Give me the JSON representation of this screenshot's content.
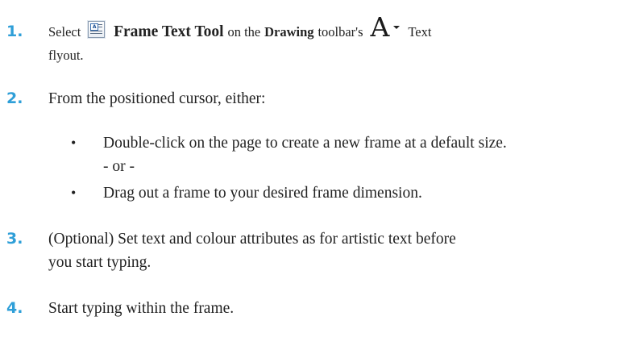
{
  "steps": [
    {
      "number": "1.",
      "text_select": "Select",
      "tool_name": "Frame Text Tool",
      "text_on_the": "on the",
      "toolbar_name": "Drawing",
      "text_toolbars": "toolbar's",
      "text_flyout_word": "Text",
      "text_flyout_end": "flyout."
    },
    {
      "number": "2.",
      "text": "From the positioned cursor, either:"
    },
    {
      "number": "3.",
      "line1": "(Optional) Set text and colour attributes as for artistic text before",
      "line2": "you start typing."
    },
    {
      "number": "4.",
      "text": "Start typing within the frame."
    }
  ],
  "bullets": [
    {
      "symbol": "•",
      "line1": "Double-click on the page to create a new frame at a default size.",
      "line2": "- or -"
    },
    {
      "symbol": "•",
      "line1": "Drag out a frame to your desired frame dimension."
    }
  ],
  "icons": {
    "frame_text_tool": "frame-text-tool-icon",
    "text_flyout": "text-flyout-icon",
    "text_flyout_glyph": "A"
  },
  "colors": {
    "step_number": "#2f9fd8",
    "text": "#222222"
  }
}
